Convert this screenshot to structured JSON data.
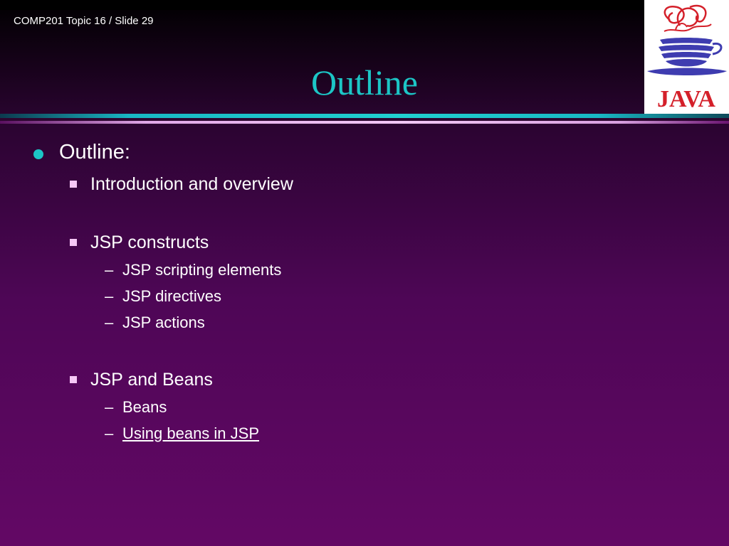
{
  "header": {
    "slide_id": "COMP201 Topic 16 / Slide 29",
    "title": "Outline"
  },
  "logo": {
    "text": "JAVA",
    "icon": "java-coffee-cup-logo"
  },
  "outline": {
    "heading": "Outline:",
    "groups": [
      {
        "label": "Introduction and overview",
        "items": []
      },
      {
        "label": "JSP constructs",
        "items": [
          "JSP scripting elements",
          "JSP directives",
          "JSP actions"
        ]
      },
      {
        "label": "JSP and Beans",
        "items": [
          "Beans",
          "Using beans in JSP"
        ]
      }
    ]
  },
  "colors": {
    "title": "#1cc6c6",
    "bullet_level1": "#1cc6c6",
    "bullet_level2": "#f6c8f6",
    "background_bottom": "#630865",
    "logo_red": "#d4202a",
    "logo_blue": "#3e3cb0"
  }
}
